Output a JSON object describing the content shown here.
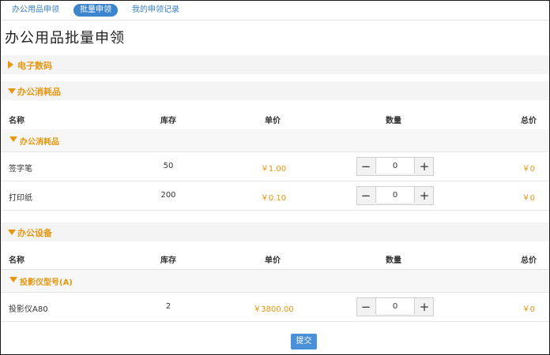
{
  "tabs": [
    {
      "label": "办公用品申领"
    },
    {
      "label": "批量申领"
    },
    {
      "label": "我的申领记录"
    }
  ],
  "page_title": "办公用品批量申领",
  "columns": {
    "name": "名称",
    "stock": "库存",
    "price": "单价",
    "qty": "数量",
    "total": "总价"
  },
  "sections": [
    {
      "label": "电子数码",
      "expanded": false
    },
    {
      "label": "办公消耗品",
      "expanded": true,
      "subcategory": "办公消耗品",
      "rows": [
        {
          "name": "签字笔",
          "stock": "50",
          "price": "￥1.00",
          "qty": "0",
          "total": "￥0"
        },
        {
          "name": "打印纸",
          "stock": "200",
          "price": "￥0.10",
          "qty": "0",
          "total": "￥0"
        }
      ]
    },
    {
      "label": "办公设备",
      "expanded": true,
      "subcategory": "投影仪型号(A)",
      "rows": [
        {
          "name": "投影仪A80",
          "stock": "2",
          "price": "￥3800.00",
          "qty": "0",
          "total": "￥0"
        }
      ]
    }
  ],
  "stepper": {
    "minus": "−",
    "plus": "+"
  },
  "submit_label": "提交",
  "colors": {
    "accent": "#e6960f",
    "primary": "#3c84cc"
  }
}
